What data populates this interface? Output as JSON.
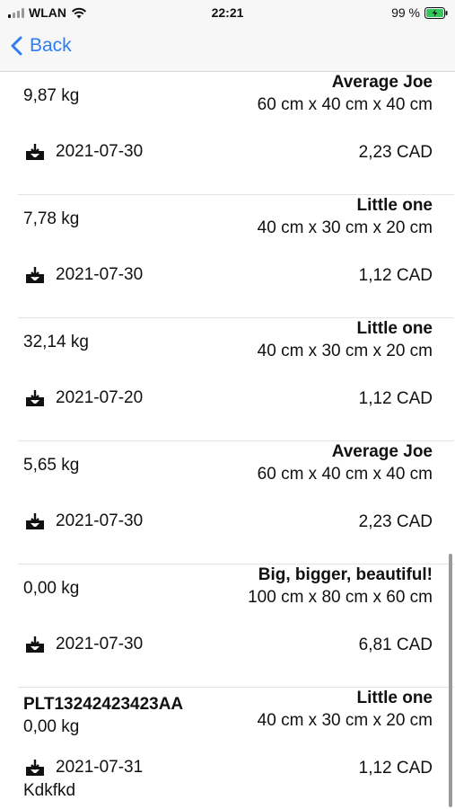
{
  "status_bar": {
    "carrier": "WLAN",
    "time": "22:21",
    "battery_percent": "99 %"
  },
  "nav": {
    "back_label": "Back"
  },
  "items": [
    {
      "title": "Average Joe",
      "weight": "9,87 kg",
      "dimensions": "60 cm x 40 cm x 40 cm",
      "date": "2021-07-30",
      "price": "2,23 CAD"
    },
    {
      "title": "Little one",
      "weight": "7,78 kg",
      "dimensions": "40 cm x 30 cm x 20 cm",
      "date": "2021-07-30",
      "price": "1,12 CAD"
    },
    {
      "title": "Little one",
      "weight": "32,14 kg",
      "dimensions": "40 cm x 30 cm x 20 cm",
      "date": "2021-07-20",
      "price": "1,12 CAD"
    },
    {
      "title": "Average Joe",
      "weight": "5,65 kg",
      "dimensions": "60 cm x 40 cm x 40 cm",
      "date": "2021-07-30",
      "price": "2,23 CAD"
    },
    {
      "title": "Big, bigger, beautiful!",
      "weight": "0,00 kg",
      "dimensions": "100 cm x 80 cm x 60 cm",
      "date": "2021-07-30",
      "price": "6,81 CAD"
    },
    {
      "title": "Little one",
      "reference": "PLT13242423423AA",
      "weight": "0,00 kg",
      "dimensions": "40 cm x 30 cm x 20 cm",
      "date": "2021-07-31",
      "price": "1,12 CAD",
      "note": "Kdkfkd"
    }
  ],
  "colors": {
    "accent": "#2f7cf6",
    "bar_background": "#f7f7f7",
    "battery_fill": "#34c759"
  },
  "icons": {
    "row_date": "tray-download-icon",
    "back": "chevron-left-icon",
    "wifi": "wifi-icon",
    "battery": "battery-charging-icon"
  }
}
